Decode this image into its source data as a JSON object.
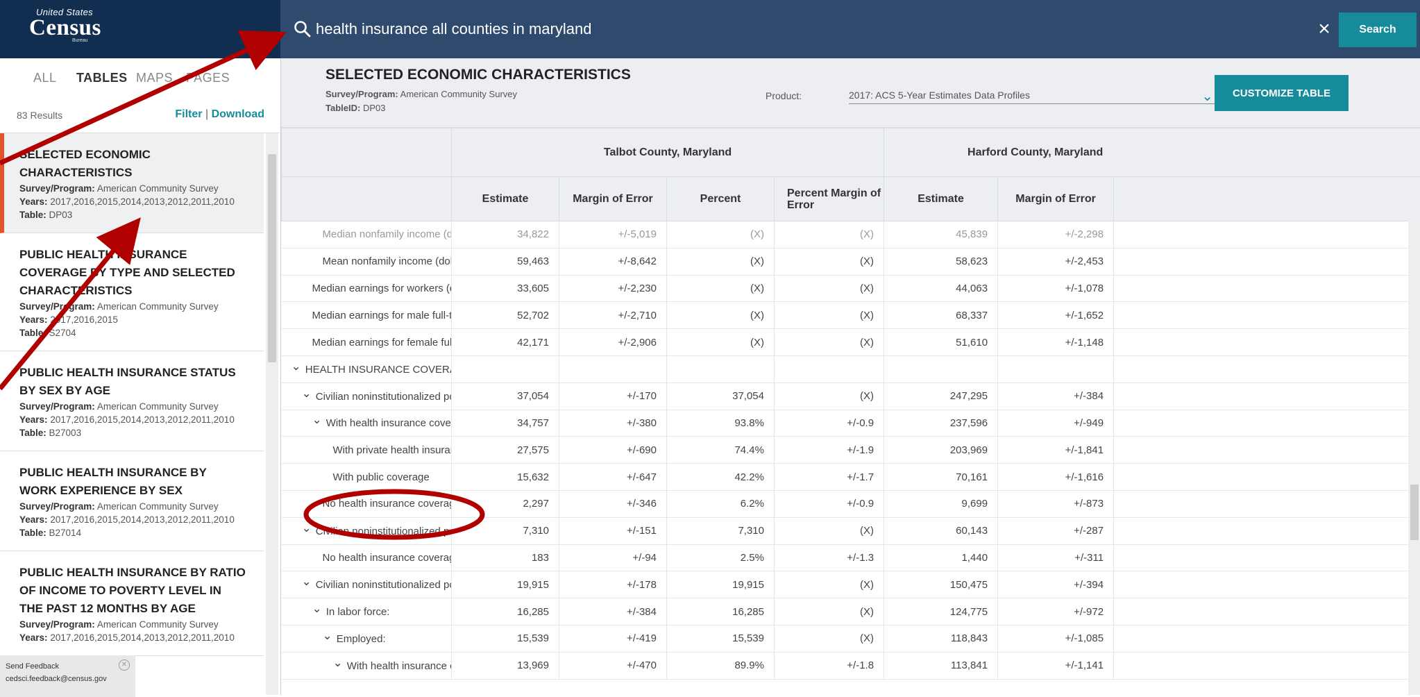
{
  "brand": {
    "line1": "United States",
    "line2": "Census",
    "line3": "Bureau"
  },
  "search": {
    "query": "health insurance all counties in maryland",
    "button_label": "Search",
    "clear_label": "×"
  },
  "sidebar": {
    "tabs": [
      "ALL",
      "TABLES",
      "MAPS",
      "PAGES"
    ],
    "active_tab": "TABLES",
    "results_count": "83 Results",
    "filter_label": "Filter",
    "separator": "|",
    "download_label": "Download",
    "results": [
      {
        "title": "SELECTED ECONOMIC CHARACTERISTICS",
        "survey_label": "Survey/Program:",
        "survey": "American Community Survey",
        "years_label": "Years:",
        "years": "2017,2016,2015,2014,2013,2012,2011,2010",
        "table_label": "Table:",
        "table": "DP03",
        "selected": true
      },
      {
        "title": "PUBLIC HEALTH INSURANCE COVERAGE BY TYPE AND SELECTED CHARACTERISTICS",
        "survey_label": "Survey/Program:",
        "survey": "American Community Survey",
        "years_label": "Years:",
        "years": "2017,2016,2015",
        "table_label": "Table:",
        "table": "S2704"
      },
      {
        "title": "PUBLIC HEALTH INSURANCE STATUS BY SEX BY AGE",
        "survey_label": "Survey/Program:",
        "survey": "American Community Survey",
        "years_label": "Years:",
        "years": "2017,2016,2015,2014,2013,2012,2011,2010",
        "table_label": "Table:",
        "table": "B27003"
      },
      {
        "title": "PUBLIC HEALTH INSURANCE BY WORK EXPERIENCE BY SEX",
        "survey_label": "Survey/Program:",
        "survey": "American Community Survey",
        "years_label": "Years:",
        "years": "2017,2016,2015,2014,2013,2012,2011,2010",
        "table_label": "Table:",
        "table": "B27014"
      },
      {
        "title": "PUBLIC HEALTH INSURANCE BY RATIO OF INCOME TO POVERTY LEVEL IN THE PAST 12 MONTHS BY AGE",
        "survey_label": "Survey/Program:",
        "survey": "American Community Survey",
        "years_label": "Years:",
        "years": "2017,2016,2015,2014,2013,2012,2011,2010",
        "table_label": "",
        "table": ""
      }
    ],
    "feedback": {
      "title": "Send Feedback",
      "email": "cedsci.feedback@census.gov"
    }
  },
  "table_view": {
    "title": "SELECTED ECONOMIC CHARACTERISTICS",
    "survey_label": "Survey/Program:",
    "survey": "American Community Survey",
    "tableid_label": "TableID:",
    "tableid": "DP03",
    "product_label": "Product:",
    "product_value": "2017: ACS 5-Year Estimates Data Profiles",
    "customize_label": "CUSTOMIZE TABLE",
    "locations": [
      "Talbot County, Maryland",
      "Harford County, Maryland"
    ],
    "columns": [
      "Estimate",
      "Margin of Error",
      "Percent",
      "Percent Margin of Error",
      "Estimate",
      "Margin of Error"
    ],
    "rows": [
      {
        "label": "Median nonfamily income (dollars)",
        "indent": 3,
        "vals": [
          "34,822",
          "+/-5,019",
          "(X)",
          "(X)",
          "45,839",
          "+/-2,298"
        ],
        "faded": true
      },
      {
        "label": "Mean nonfamily income (dollars)",
        "indent": 3,
        "vals": [
          "59,463",
          "+/-8,642",
          "(X)",
          "(X)",
          "58,623",
          "+/-2,453"
        ]
      },
      {
        "label": "Median earnings for workers (dolla...",
        "indent": 2,
        "vals": [
          "33,605",
          "+/-2,230",
          "(X)",
          "(X)",
          "44,063",
          "+/-1,078"
        ]
      },
      {
        "label": "Median earnings for male full-time,...",
        "indent": 2,
        "vals": [
          "52,702",
          "+/-2,710",
          "(X)",
          "(X)",
          "68,337",
          "+/-1,652"
        ]
      },
      {
        "label": "Median earnings for female full-ti...",
        "indent": 2,
        "vals": [
          "42,171",
          "+/-2,906",
          "(X)",
          "(X)",
          "51,610",
          "+/-1,148"
        ]
      },
      {
        "label": "HEALTH INSURANCE COVERAGE",
        "indent": 0,
        "chevron": true,
        "vals": [
          "",
          "",
          "",
          "",
          "",
          ""
        ]
      },
      {
        "label": "Civilian noninstitutionalized popula...",
        "indent": 1,
        "chevron": true,
        "vals": [
          "37,054",
          "+/-170",
          "37,054",
          "(X)",
          "247,295",
          "+/-384"
        ]
      },
      {
        "label": "With health insurance coverage",
        "indent": 2,
        "chevron": true,
        "vals": [
          "34,757",
          "+/-380",
          "93.8%",
          "+/-0.9",
          "237,596",
          "+/-949"
        ]
      },
      {
        "label": "With private health insurance",
        "indent": 4,
        "vals": [
          "27,575",
          "+/-690",
          "74.4%",
          "+/-1.9",
          "203,969",
          "+/-1,841"
        ]
      },
      {
        "label": "With public coverage",
        "indent": 4,
        "vals": [
          "15,632",
          "+/-647",
          "42.2%",
          "+/-1.7",
          "70,161",
          "+/-1,616"
        ]
      },
      {
        "label": "No health insurance coverage",
        "indent": 3,
        "vals": [
          "2,297",
          "+/-346",
          "6.2%",
          "+/-0.9",
          "9,699",
          "+/-873"
        ]
      },
      {
        "label": "Civilian noninstitutionalized popula...",
        "indent": 1,
        "chevron": true,
        "vals": [
          "7,310",
          "+/-151",
          "7,310",
          "(X)",
          "60,143",
          "+/-287"
        ]
      },
      {
        "label": "No health insurance coverage",
        "indent": 3,
        "vals": [
          "183",
          "+/-94",
          "2.5%",
          "+/-1.3",
          "1,440",
          "+/-311"
        ]
      },
      {
        "label": "Civilian noninstitutionalized popula...",
        "indent": 1,
        "chevron": true,
        "vals": [
          "19,915",
          "+/-178",
          "19,915",
          "(X)",
          "150,475",
          "+/-394"
        ]
      },
      {
        "label": "In labor force:",
        "indent": 2,
        "chevron": true,
        "vals": [
          "16,285",
          "+/-384",
          "16,285",
          "(X)",
          "124,775",
          "+/-972"
        ]
      },
      {
        "label": "Employed:",
        "indent": 3,
        "chevron": true,
        "vals": [
          "15,539",
          "+/-419",
          "15,539",
          "(X)",
          "118,843",
          "+/-1,085"
        ]
      },
      {
        "label": "With health insurance covera...",
        "indent": 4,
        "chevron": true,
        "vals": [
          "13,969",
          "+/-470",
          "89.9%",
          "+/-1.8",
          "113,841",
          "+/-1,141"
        ]
      }
    ]
  },
  "colors": {
    "navy": "#112e51",
    "search_bar": "#2f4a6d",
    "teal": "#168b9b",
    "accent": "#e0542c",
    "annotation": "#b00000"
  }
}
